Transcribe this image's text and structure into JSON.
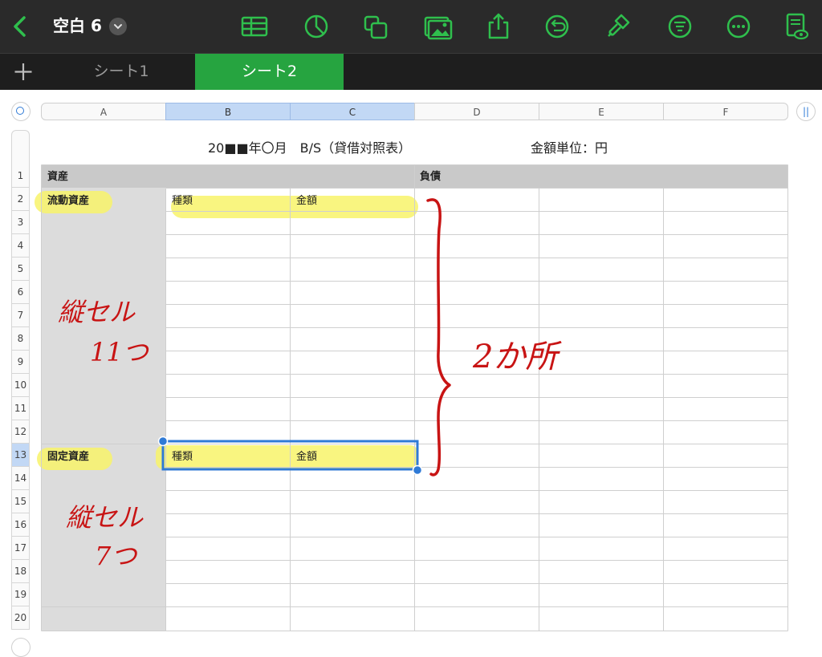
{
  "toolbar": {
    "title": "空白 6",
    "icons": [
      "back-chevron-icon",
      "chevron-down-icon",
      "table-icon",
      "chart-icon",
      "shape-icon",
      "media-icon",
      "share-icon",
      "undo-icon",
      "format-brush-icon",
      "organize-icon",
      "more-icon",
      "view-options-icon"
    ],
    "accent": "#2fbf4d"
  },
  "tabs": {
    "add_label": "+",
    "sheets": [
      "シート1",
      "シート2"
    ],
    "active": "シート2",
    "active_color": "#26a440"
  },
  "columns": [
    "A",
    "B",
    "C",
    "D",
    "E",
    "F"
  ],
  "selected_columns": [
    "B",
    "C"
  ],
  "rows": [
    "1",
    "2",
    "3",
    "4",
    "5",
    "6",
    "7",
    "8",
    "9",
    "10",
    "11",
    "12",
    "13",
    "14",
    "15",
    "16",
    "17",
    "18",
    "19",
    "20"
  ],
  "selected_row": "13",
  "sheet": {
    "title": "20■■年〇月　B/S（貸借対照表）",
    "unit": "金額単位：円",
    "header_left": "資産",
    "header_right": "負債",
    "current_assets": "流動資産",
    "fixed_assets": "固定資産",
    "type_label": "種類",
    "amount_label": "金額"
  },
  "annotations": {
    "note_current_line1": "縦セル",
    "note_current_line2": "11つ",
    "note_fixed_line1": "縦セル",
    "note_fixed_line2": "7つ",
    "note_places": "2か所",
    "ink_color": "#c81414",
    "highlight_color": "#f8f36a"
  },
  "selection_color": "#2f7ad6"
}
